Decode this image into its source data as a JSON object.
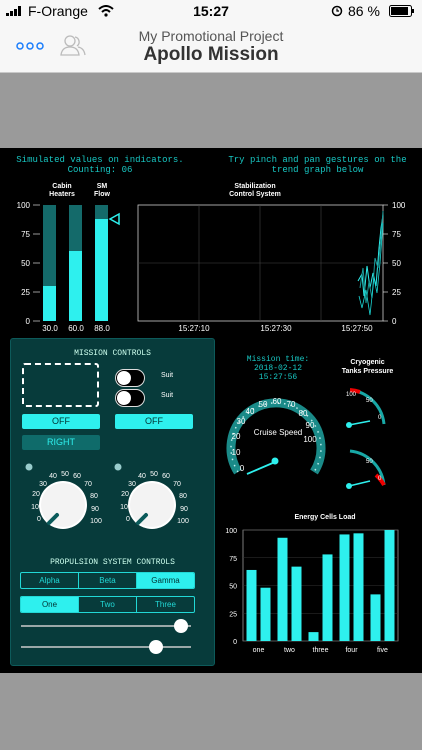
{
  "status": {
    "carrier": "F-Orange",
    "time": "15:27",
    "battery": "86 %"
  },
  "nav": {
    "subtitle": "My Promotional Project",
    "title": "Apollo Mission",
    "menu_icon": "dots-icon",
    "people_icon": "users-icon"
  },
  "header": {
    "left_line1": "Simulated values on indicators.",
    "left_line2": "Counting: 06",
    "right_line1": "Try pinch and pan gestures on the",
    "right_line2": "trend graph below"
  },
  "colors": {
    "accent": "#2ef0ee",
    "panel": "#073b3b",
    "dark": "#000000"
  },
  "bars": {
    "labels": [
      [
        "Cabin",
        "Heaters"
      ],
      [
        "",
        ""
      ],
      [
        "SM",
        "Flow"
      ]
    ],
    "scale": [
      "100",
      "75",
      "50",
      "25",
      "0"
    ],
    "values": [
      "30.0",
      "60.0",
      "88.0"
    ]
  },
  "trend": {
    "title1": "Stabilization",
    "title2": "Control System",
    "right_scale": [
      "100",
      "75",
      "50",
      "25",
      "0"
    ],
    "times": [
      "15:27:10",
      "15:27:30",
      "15:27:50"
    ]
  },
  "mission": {
    "title": "MISSION CONTROLS",
    "suit1": "Suit",
    "suit2": "Suit",
    "off1": "OFF",
    "off2": "OFF",
    "right": "RIGHT",
    "dial_labels": [
      "0",
      "10",
      "20",
      "30",
      "40",
      "50",
      "60",
      "70",
      "80",
      "90",
      "100"
    ]
  },
  "propulsion": {
    "title": "PROPULSION SYSTEM CONTROLS",
    "seg1": [
      "Alpha",
      "Beta",
      "Gamma"
    ],
    "seg2": [
      "One",
      "Two",
      "Three"
    ]
  },
  "mission_time": {
    "label": "Mission time:",
    "date": "2018-02-12",
    "time": "15:27:56"
  },
  "cryo": {
    "title1": "Cryogenic",
    "title2": "Tanks Pressure",
    "labels": [
      "0",
      "50",
      "100"
    ]
  },
  "speed": {
    "title": "Cruise Speed",
    "labels": [
      "0",
      "10",
      "20",
      "30",
      "40",
      "50",
      "60",
      "70",
      "80",
      "90",
      "100"
    ]
  },
  "chart_data": {
    "type": "bar",
    "title": "Energy Cells Load",
    "categories": [
      "one",
      "two",
      "three",
      "four",
      "five"
    ],
    "ylim": [
      0,
      100
    ],
    "yticks": [
      "0",
      "25",
      "50",
      "75",
      "100"
    ],
    "series": [
      {
        "values": [
          64,
          93,
          8,
          96,
          42
        ]
      },
      {
        "values": [
          48,
          67,
          78,
          97,
          100
        ]
      }
    ]
  }
}
